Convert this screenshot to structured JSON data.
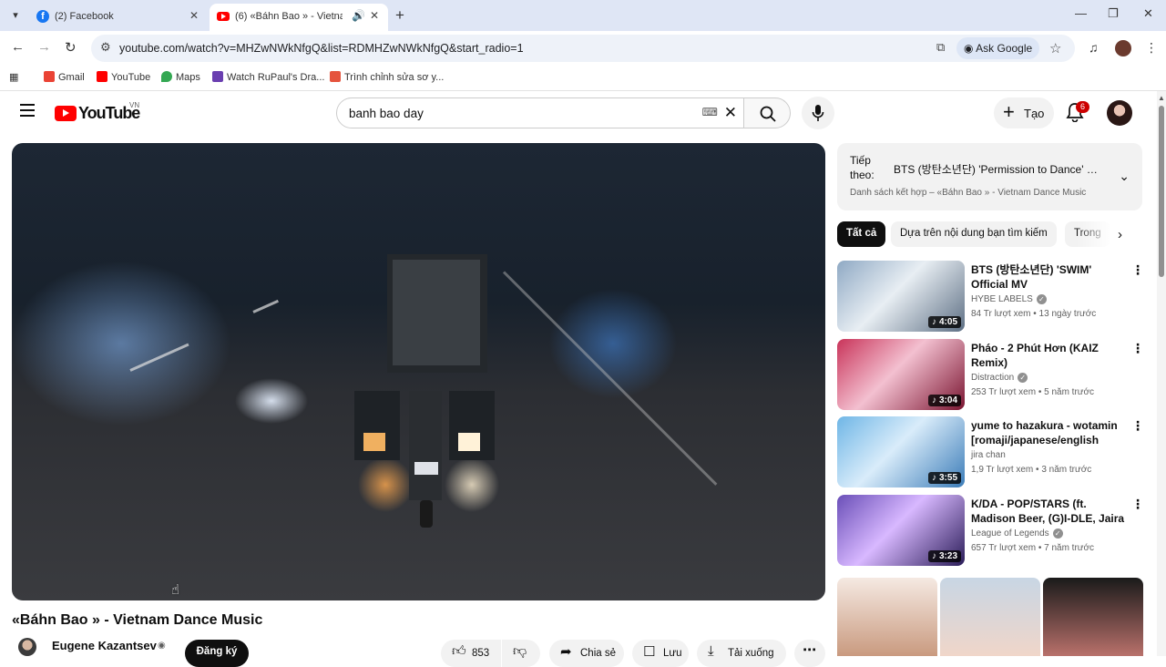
{
  "browser": {
    "tabs": [
      {
        "title": "(2) Facebook",
        "favicon": "facebook-icon"
      },
      {
        "title": "(6) «Báhn Bao » - Vietnam",
        "favicon": "youtube-icon",
        "audio": true
      }
    ],
    "url": "youtube.com/watch?v=MHZwNWkNfgQ&list=RDMHZwNWkNfgQ&start_radio=1",
    "ask_google": "Ask Google",
    "bookmarks": [
      "Gmail",
      "YouTube",
      "Maps",
      "Watch RuPaul's Dra...",
      "Trình chỉnh sửa sơ y..."
    ]
  },
  "youtube": {
    "logo_text": "YouTube",
    "country_code": "VN",
    "search_query": "banh bao day",
    "create_label": "Tạo",
    "notification_count": "6"
  },
  "video": {
    "title": "«Báhn Bao » - Vietnam Dance Music",
    "channel": "Eugene Kazantsev",
    "subscribe_label": "Đăng ký",
    "likes": "853",
    "share_label": "Chia sẻ",
    "save_label": "Lưu",
    "download_label": "Tải xuống"
  },
  "up_next": {
    "label": "Tiếp theo:",
    "title": "BTS (방탄소년단) 'Permission to Dance' O...",
    "mix": "Danh sách kết hợp – «Báhn Bao » - Vietnam Dance Music"
  },
  "chips": [
    "Tất cả",
    "Dựa trên nội dung bạn tìm kiếm",
    "Trong"
  ],
  "recommendations": [
    {
      "title": "BTS (방탄소년단) 'SWIM' Official MV",
      "channel": "HYBE LABELS",
      "verified": true,
      "meta": "84 Tr lượt xem • 13 ngày trước",
      "duration": "4:05",
      "thumb_colors": [
        "#8fa9c4",
        "#e8eef3",
        "#5d6f84"
      ]
    },
    {
      "title": "Pháo - 2 Phút Hơn (KAIZ Remix)",
      "channel": "Distraction",
      "verified": true,
      "meta": "253 Tr lượt xem • 5 năm trước",
      "duration": "3:04",
      "thumb_colors": [
        "#c9345a",
        "#f3c0d0",
        "#7a1430"
      ]
    },
    {
      "title": "yume to hazakura - wotamin [romaji/japanese/english lyric...",
      "channel": "jira chan",
      "verified": false,
      "meta": "1,9 Tr lượt xem • 3 năm trước",
      "duration": "3:55",
      "thumb_colors": [
        "#6fb6e6",
        "#d9ecfa",
        "#3b7cb8"
      ]
    },
    {
      "title": "K/DA - POP/STARS (ft. Madison Beer, (G)I-DLE, Jaira Burns) | ...",
      "channel": "League of Legends",
      "verified": true,
      "meta": "657 Tr lượt xem • 7 năm trước",
      "duration": "3:23",
      "thumb_colors": [
        "#6a4fb8",
        "#d8b8ff",
        "#2a1c58"
      ]
    }
  ],
  "colors": {
    "youtube_red": "#ff0000",
    "chip_selected": "#0f0f0f",
    "secondary_text": "#606060"
  }
}
